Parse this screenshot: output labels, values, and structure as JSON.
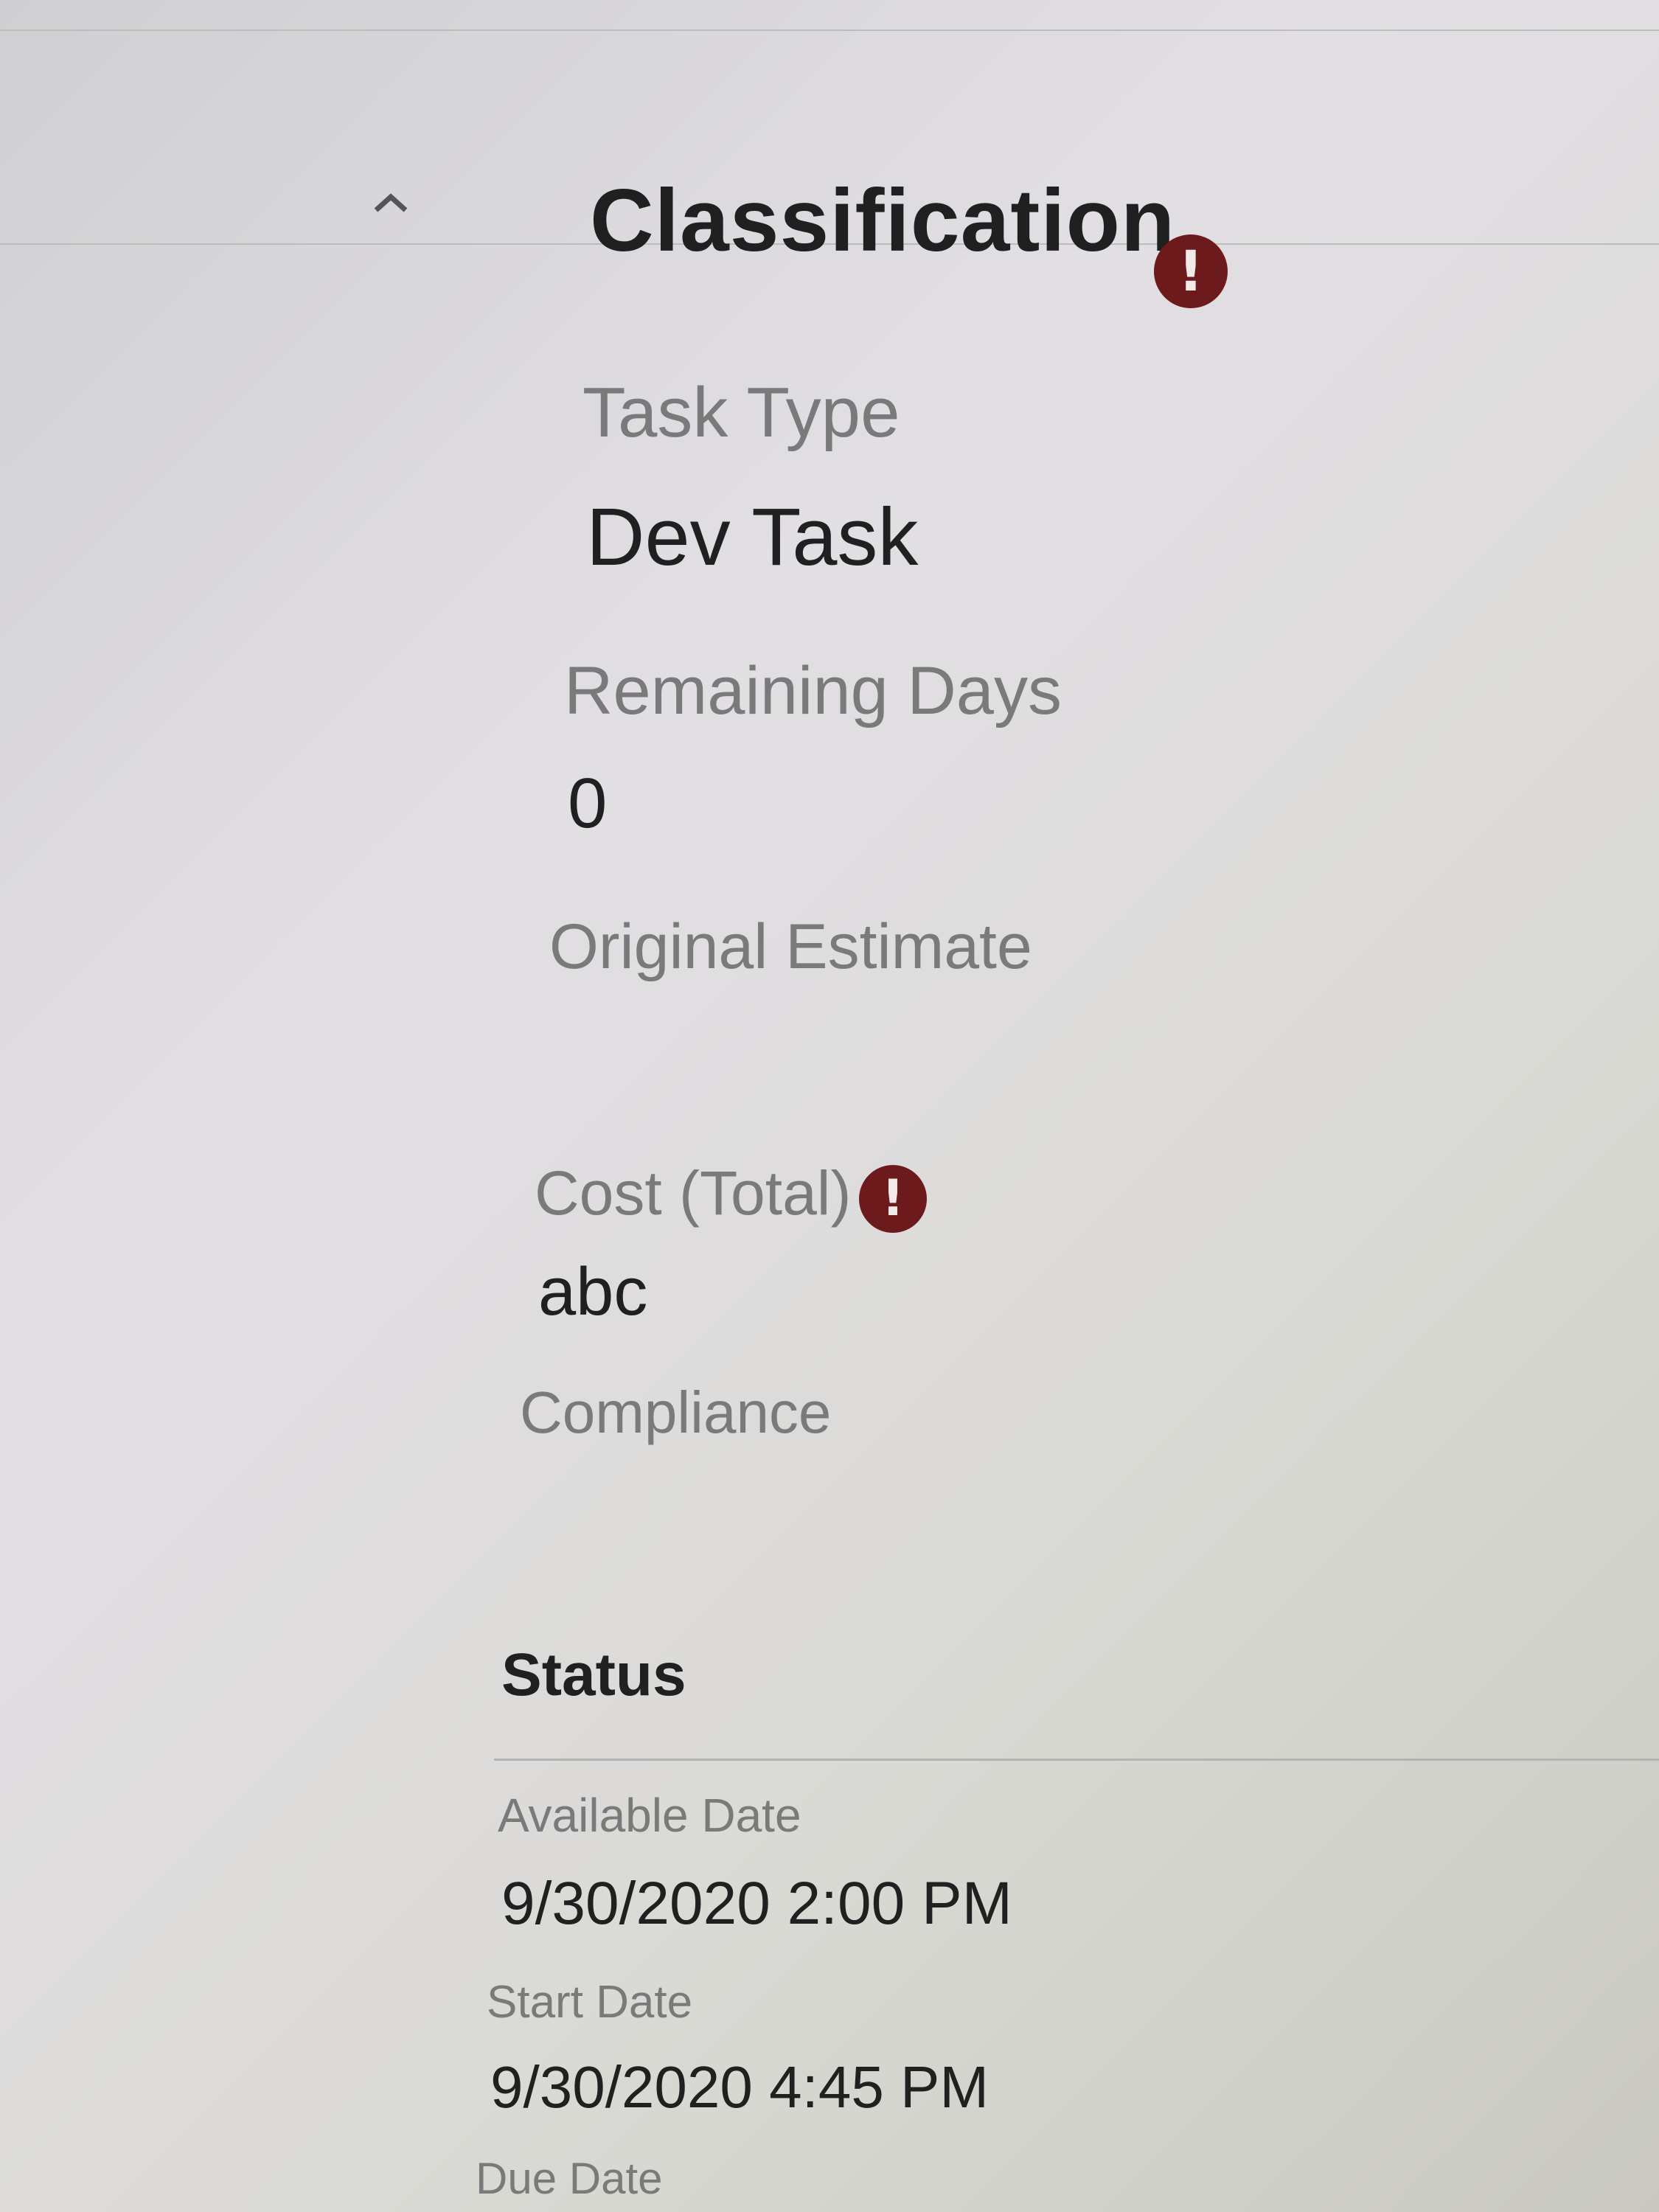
{
  "classification": {
    "title": "Classification",
    "alert_icon": "exclamation-circle-icon",
    "collapse_icon": "chevron-up-icon",
    "fields": {
      "task_type": {
        "label": "Task Type",
        "value": "Dev Task"
      },
      "remaining_days": {
        "label": "Remaining Days",
        "value": "0"
      },
      "original_estimate": {
        "label": "Original Estimate",
        "value": ""
      },
      "cost_total": {
        "label": "Cost (Total)",
        "value": "abc"
      },
      "compliance": {
        "label": "Compliance",
        "value": ""
      }
    }
  },
  "status": {
    "title": "Status",
    "fields": {
      "available_date": {
        "label": "Available Date",
        "value": "9/30/2020 2:00 PM"
      },
      "start_date": {
        "label": "Start Date",
        "value": "9/30/2020 4:45 PM"
      },
      "due_date": {
        "label": "Due Date",
        "value": ""
      }
    }
  },
  "colors": {
    "alert": "#6d1a1d",
    "label_text": "#7a7a7a",
    "value_text": "#202020"
  }
}
